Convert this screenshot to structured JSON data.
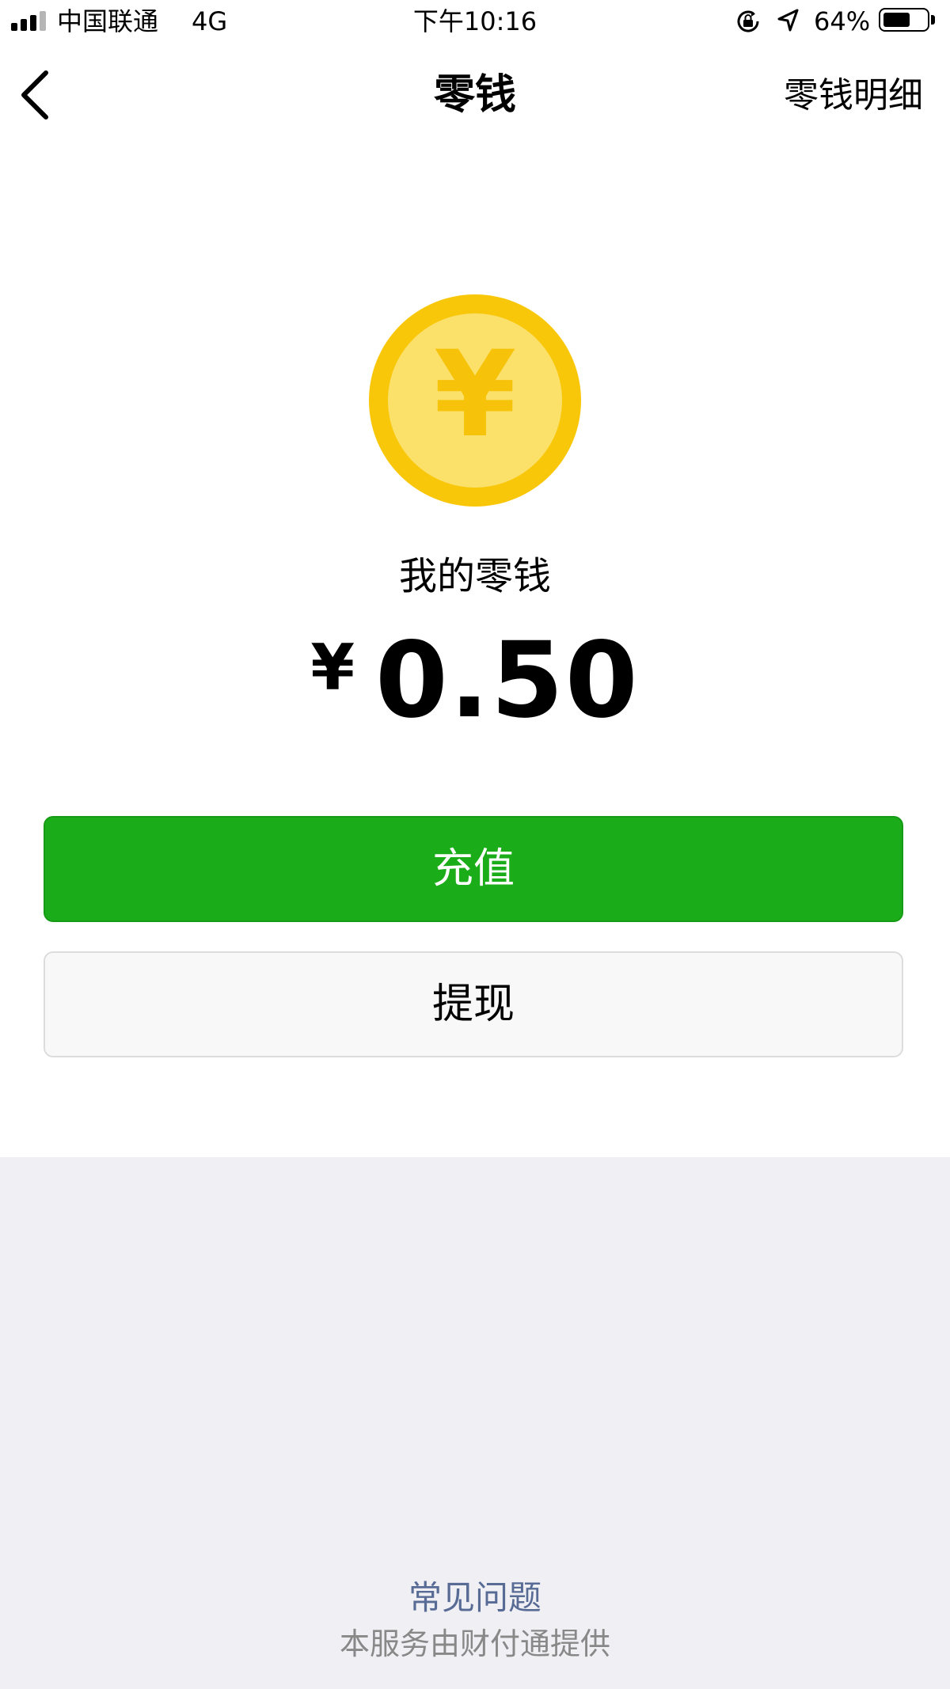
{
  "status_bar": {
    "carrier": "中国联通",
    "network": "4G",
    "time": "下午10:16",
    "battery_percent": "64%",
    "battery_level": 0.64,
    "signal_bars_active": 3,
    "icons": [
      "signal-icon",
      "orientation-lock-icon",
      "location-icon",
      "battery-icon"
    ]
  },
  "nav": {
    "back_icon": "chevron-left-icon",
    "title": "零钱",
    "right_link": "零钱明细"
  },
  "wallet": {
    "coin_icon": "yuan-coin-icon",
    "coin_symbol": "¥",
    "label": "我的零钱",
    "currency": "¥",
    "amount": "0.50"
  },
  "actions": {
    "recharge": "充值",
    "withdraw": "提现"
  },
  "footer": {
    "faq": "常见问题",
    "provider": "本服务由财付通提供"
  },
  "colors": {
    "primary_green": "#1aad19",
    "coin_outer": "#f9c70a",
    "coin_inner": "#fbe06a",
    "link_blue": "#576b95",
    "footer_bg": "#efeff4"
  }
}
